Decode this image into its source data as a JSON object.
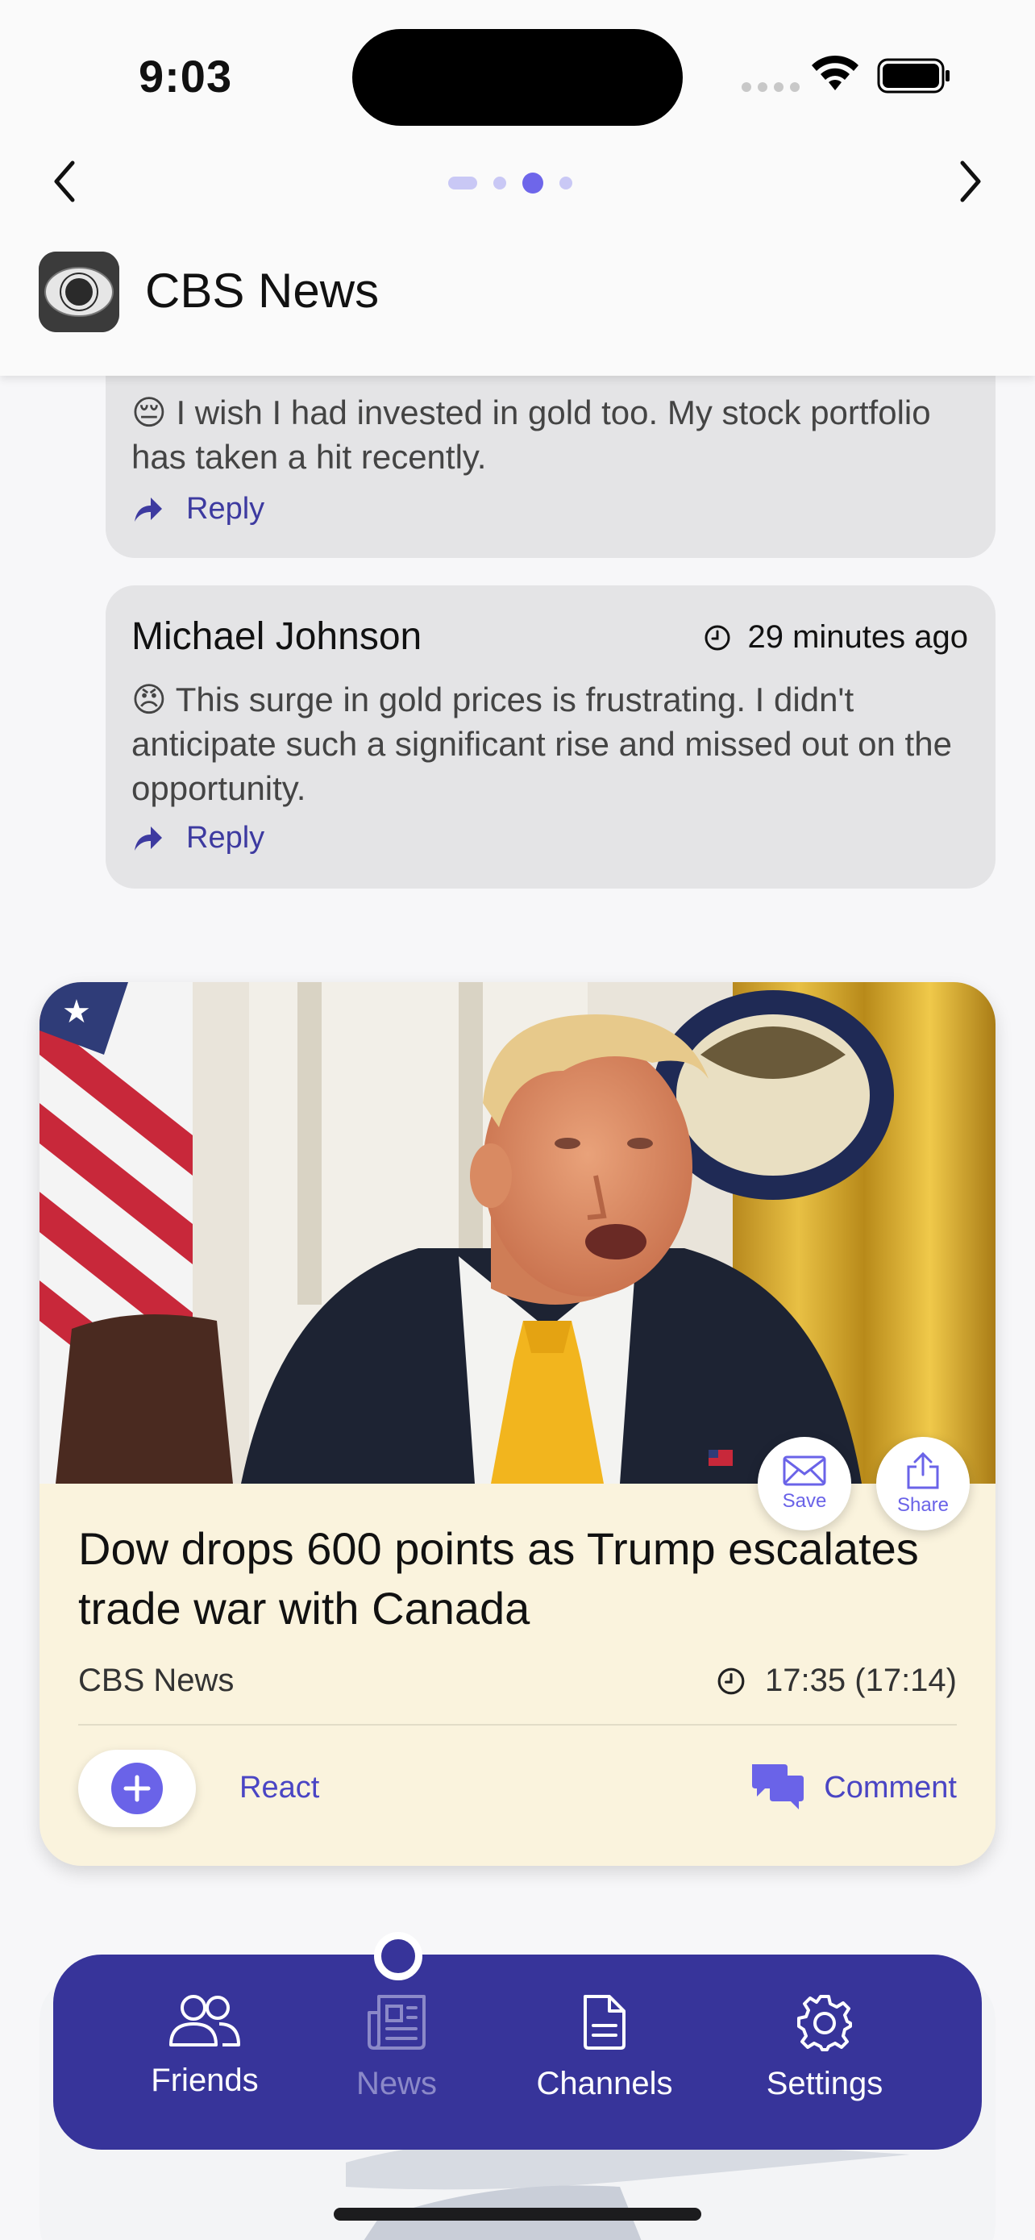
{
  "status_bar": {
    "time": "9:03"
  },
  "header": {
    "channel_name": "CBS News",
    "pager": {
      "count": 4,
      "current_index": 2
    }
  },
  "comments": [
    {
      "author": "",
      "time": "",
      "emoji": "😔",
      "text": "I wish I had invested in gold too. My stock portfolio has taken a hit recently.",
      "reply_label": "Reply"
    },
    {
      "author": "Michael Johnson",
      "time": "29 minutes ago",
      "emoji": "😠",
      "text": "This surge in gold prices is frustrating. I didn't anticipate such a significant rise and missed out on the opportunity.",
      "reply_label": "Reply"
    }
  ],
  "news_card": {
    "headline": "Dow drops 600 points as Trump escalates trade war with Canada",
    "source": "CBS News",
    "time": "17:35 (17:14)",
    "save_label": "Save",
    "share_label": "Share",
    "react_label": "React",
    "comment_label": "Comment"
  },
  "tabbar": {
    "active": "News",
    "tabs": [
      {
        "label": "Friends",
        "icon": "friends-icon"
      },
      {
        "label": "News",
        "icon": "newspaper-icon"
      },
      {
        "label": "Channels",
        "icon": "document-icon"
      },
      {
        "label": "Settings",
        "icon": "gear-icon"
      }
    ]
  },
  "colors": {
    "accent": "#6a63e8",
    "tabbar": "#37349a",
    "card_bg": "#faf3dd",
    "comment_bg": "#e4e4e6",
    "link": "#4a45c4"
  }
}
